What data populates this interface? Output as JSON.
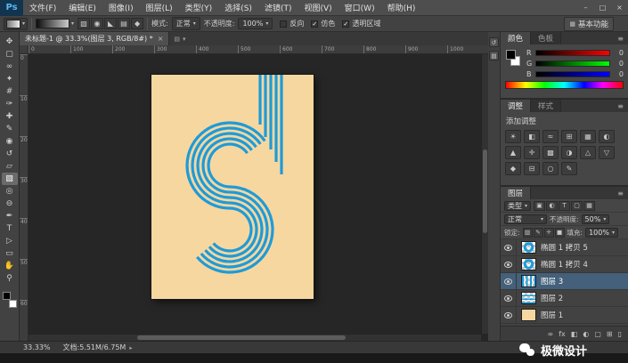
{
  "colors": {
    "poster_bg": "#f7d7a0",
    "artwork_blue": "#1e9bd8",
    "selection_blue": "#44607a"
  },
  "icons": {
    "dropdown": "▾",
    "panel_menu": "≡",
    "workspace_grid": "▦"
  },
  "window": {
    "controls": [
      "–",
      "□",
      "×"
    ]
  },
  "menubar": {
    "logo": "Ps",
    "items": [
      "文件(F)",
      "编辑(E)",
      "图像(I)",
      "图层(L)",
      "类型(Y)",
      "选择(S)",
      "滤镜(T)",
      "视图(V)",
      "窗口(W)",
      "帮助(H)"
    ]
  },
  "optionsbar": {
    "mode_label": "模式:",
    "mode_value": "正常",
    "opacity_label": "不透明度:",
    "opacity_value": "100%",
    "checks": [
      {
        "label": "反向",
        "mark": ""
      },
      {
        "label": "仿色",
        "mark": "✓"
      },
      {
        "label": "透明区域",
        "mark": "✓"
      }
    ],
    "gradient_types": [
      "▧",
      "◉",
      "◣",
      "▤",
      "◆"
    ],
    "workspace": "基本功能"
  },
  "tabbar": {
    "title": "未标题-1 @ 33.3%(图层 3, RGB/8#) *",
    "close": "×",
    "extras": [
      "▤",
      "▾"
    ]
  },
  "rulers": {
    "h": [
      "0",
      "100",
      "200",
      "300",
      "400",
      "500",
      "600",
      "700",
      "800",
      "900",
      "1000"
    ],
    "v": [
      "0",
      "100",
      "200",
      "300",
      "400",
      "500",
      "600"
    ]
  },
  "toolbar": {
    "tools": [
      {
        "name": "move-tool",
        "glyph": "✥",
        "sel": ""
      },
      {
        "name": "marquee-tool",
        "glyph": "▢",
        "sel": ""
      },
      {
        "name": "lasso-tool",
        "glyph": "∞",
        "sel": ""
      },
      {
        "name": "quick-select-tool",
        "glyph": "✦",
        "sel": ""
      },
      {
        "name": "crop-tool",
        "glyph": "#",
        "sel": ""
      },
      {
        "name": "eyedropper-tool",
        "glyph": "✑",
        "sel": ""
      },
      {
        "name": "healing-brush-tool",
        "glyph": "✚",
        "sel": ""
      },
      {
        "name": "brush-tool",
        "glyph": "✎",
        "sel": ""
      },
      {
        "name": "clone-stamp-tool",
        "glyph": "◉",
        "sel": ""
      },
      {
        "name": "history-brush-tool",
        "glyph": "↺",
        "sel": ""
      },
      {
        "name": "eraser-tool",
        "glyph": "▱",
        "sel": ""
      },
      {
        "name": "gradient-tool",
        "glyph": "▧",
        "sel": "sel"
      },
      {
        "name": "blur-tool",
        "glyph": "◎",
        "sel": ""
      },
      {
        "name": "dodge-tool",
        "glyph": "⊖",
        "sel": ""
      },
      {
        "name": "pen-tool",
        "glyph": "✒",
        "sel": ""
      },
      {
        "name": "type-tool",
        "glyph": "T",
        "sel": ""
      },
      {
        "name": "path-select-tool",
        "glyph": "▷",
        "sel": ""
      },
      {
        "name": "shape-tool",
        "glyph": "▭",
        "sel": ""
      },
      {
        "name": "hand-tool",
        "glyph": "✋",
        "sel": ""
      },
      {
        "name": "zoom-tool",
        "glyph": "⚲",
        "sel": ""
      }
    ]
  },
  "dock_strip_icons": [
    "↺",
    "▤"
  ],
  "color_panel": {
    "tabs": [
      {
        "label": "颜色",
        "sel": "sel"
      },
      {
        "label": "色板",
        "sel": ""
      }
    ],
    "sliders": [
      {
        "ch": "R",
        "val": "0",
        "grad": "g-r"
      },
      {
        "ch": "G",
        "val": "0",
        "grad": "g-g"
      },
      {
        "ch": "B",
        "val": "0",
        "grad": "g-b"
      }
    ]
  },
  "adjust_panel": {
    "tabs": [
      {
        "label": "调整",
        "sel": "sel"
      },
      {
        "label": "样式",
        "sel": ""
      }
    ],
    "title": "添加调整",
    "icons": [
      "☀",
      "◧",
      "≈",
      "⊞",
      "▦",
      "◐",
      "▲",
      "✛",
      "▩",
      "◑",
      "△",
      "▽",
      "◆",
      "⊟",
      "○",
      "✎"
    ]
  },
  "layers_panel": {
    "tab": "图层",
    "filter_label": "类型",
    "filter_icons": [
      "▣",
      "◐",
      "T",
      "▢",
      "▦"
    ],
    "blend_value": "正常",
    "opacity_label": "不透明度:",
    "opacity_value": "50%",
    "lock_label": "锁定:",
    "lock_icons": [
      "▨",
      "✎",
      "✛",
      "■"
    ],
    "fill_label": "填充:",
    "fill_value": "100%",
    "layers": [
      {
        "name": "椭圆 1 拷贝 5",
        "thumb": "t-ring",
        "sel": ""
      },
      {
        "name": "椭圆 1 拷贝 4",
        "thumb": "t-ring",
        "sel": ""
      },
      {
        "name": "图层 3",
        "thumb": "t-lines",
        "sel": "sel"
      },
      {
        "name": "图层 2",
        "thumb": "t-dots",
        "sel": ""
      },
      {
        "name": "图层 1",
        "thumb": "t-solid",
        "sel": ""
      }
    ],
    "bottom_icons": [
      "∞",
      "fx",
      "◧",
      "◐",
      "▢",
      "⊞",
      "▯"
    ]
  },
  "statusbar": {
    "zoom": "33.33%",
    "doc": "文档:5.51M/6.75M",
    "arrow": "▸"
  },
  "watermark": {
    "text": "极微设计"
  },
  "artwork": {
    "bg": "#f7d7a0",
    "line": "#1e9bd8",
    "stripes": 5,
    "spacing": 6,
    "stroke": 3.2
  }
}
